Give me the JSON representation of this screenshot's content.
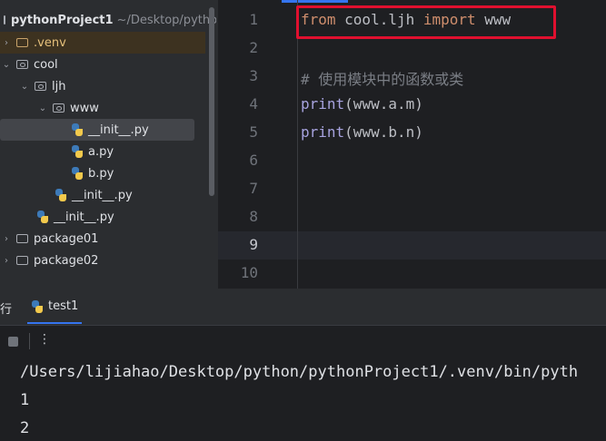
{
  "project_tree": {
    "root_name": "pythonProject1",
    "root_path": "~/Desktop/pytho",
    "items": [
      {
        "label": ".venv",
        "kind": "folder"
      },
      {
        "label": "cool",
        "kind": "package"
      },
      {
        "label": "ljh",
        "kind": "package"
      },
      {
        "label": "www",
        "kind": "package"
      },
      {
        "label": "__init__.py",
        "kind": "python-file"
      },
      {
        "label": "a.py",
        "kind": "python-file"
      },
      {
        "label": "b.py",
        "kind": "python-file"
      },
      {
        "label": "__init__.py",
        "kind": "python-file"
      },
      {
        "label": "__init__.py",
        "kind": "python-file"
      },
      {
        "label": "package01",
        "kind": "folder"
      },
      {
        "label": "package02",
        "kind": "folder"
      }
    ]
  },
  "editor": {
    "line_numbers": [
      "1",
      "2",
      "3",
      "4",
      "5",
      "6",
      "7",
      "8",
      "9",
      "10"
    ],
    "current_line": "9",
    "code": {
      "line1_kw_from": "from",
      "line1_module": " cool.ljh ",
      "line1_kw_import": "import",
      "line1_name": " www",
      "line3_comment": "# 使用模块中的函数或类",
      "line4_fn": "print",
      "line4_args": "(www.a.m)",
      "line5_fn": "print",
      "line5_args": "(www.b.n)"
    },
    "highlight_color": "#e0102f"
  },
  "run_panel": {
    "header_label": "行",
    "tab_label": "test1",
    "more_glyph": "⋮",
    "console": [
      "/Users/lijiahao/Desktop/python/pythonProject1/.venv/bin/pyth",
      "1",
      "2"
    ]
  },
  "colors": {
    "keyword": "#cf8e6d",
    "function": "#a7a3df",
    "comment": "#7a7e85",
    "accent": "#3574f0"
  }
}
